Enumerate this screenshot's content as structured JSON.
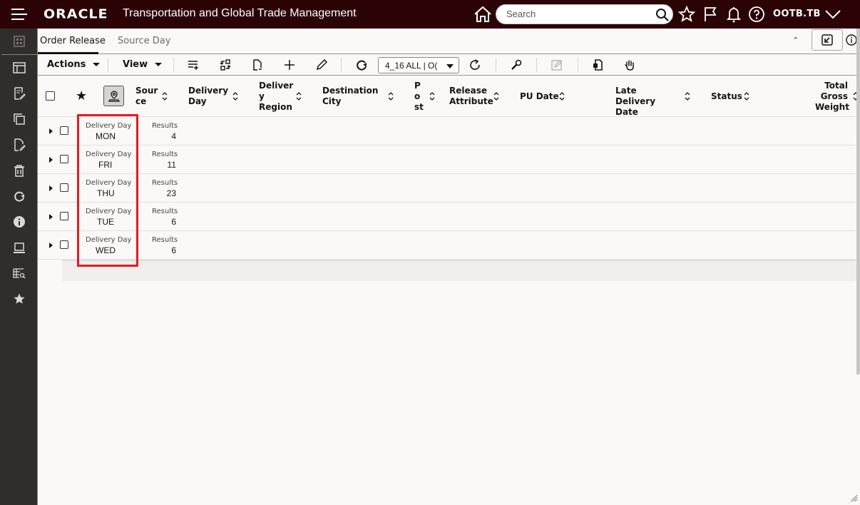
{
  "header": {
    "logo": "ORACLE",
    "app_title": "Transportation and Global Trade Management",
    "search_placeholder": "Search",
    "user": "OOTB.TB"
  },
  "tabs": [
    {
      "label": "Order Release",
      "active": true
    },
    {
      "label": "Source Day",
      "active": false
    }
  ],
  "toolbar": {
    "actions_label": "Actions",
    "view_label": "View",
    "saved_query_value": "4_16 ALL | O("
  },
  "columns": [
    {
      "label": "Sour ce"
    },
    {
      "label": "Delivery Day"
    },
    {
      "label": "Deliver y Region"
    },
    {
      "label": "Destination City"
    },
    {
      "label": "P o st"
    },
    {
      "label": "Release Attribute"
    },
    {
      "label": "PU Date"
    },
    {
      "label": "Late Delivery Date"
    },
    {
      "label": "Status"
    },
    {
      "label": "Total Gross Weight"
    }
  ],
  "groups": [
    {
      "group_label": "Delivery Day",
      "group_value": "MON",
      "results_label": "Results",
      "results": "4"
    },
    {
      "group_label": "Delivery Day",
      "group_value": "FRI",
      "results_label": "Results",
      "results": "11"
    },
    {
      "group_label": "Delivery Day",
      "group_value": "THU",
      "results_label": "Results",
      "results": "23"
    },
    {
      "group_label": "Delivery Day",
      "group_value": "TUE",
      "results_label": "Results",
      "results": "6"
    },
    {
      "group_label": "Delivery Day",
      "group_value": "WED",
      "results_label": "Results",
      "results": "6"
    }
  ],
  "colors": {
    "topbar": "#2b0305",
    "sidebar": "#312d2a",
    "highlight": "#e41c23"
  }
}
